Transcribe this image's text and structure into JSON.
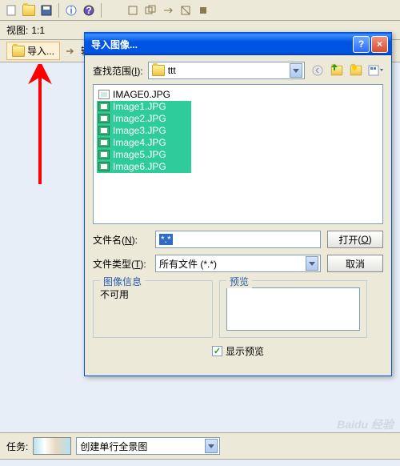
{
  "toolbar": {
    "view_label": "视图:",
    "view_value": "1:1",
    "import_label": "导入...",
    "input_label": "输"
  },
  "dialog": {
    "title": "导入图像...",
    "lookin_label": "查找范围",
    "lookin_hotkey": "I",
    "folder_name": "ttt",
    "files": [
      {
        "name": "IMAGE0.JPG",
        "selected": false
      },
      {
        "name": "Image1.JPG",
        "selected": true
      },
      {
        "name": "Image2.JPG",
        "selected": true
      },
      {
        "name": "Image3.JPG",
        "selected": true
      },
      {
        "name": "Image4.JPG",
        "selected": true
      },
      {
        "name": "Image5.JPG",
        "selected": true
      },
      {
        "name": "Image6.JPG",
        "selected": true
      }
    ],
    "filename_label": "文件名",
    "filename_hotkey": "N",
    "filename_value": "*.*",
    "filetype_label": "文件类型",
    "filetype_hotkey": "T",
    "filetype_value": "所有文件 (*.*)",
    "open_label": "打开",
    "open_hotkey": "O",
    "cancel_label": "取消",
    "imageinfo_legend": "图像信息",
    "imageinfo_text": "不可用",
    "preview_legend": "预览",
    "show_preview_label": "显示预览"
  },
  "taskbar": {
    "label": "任务:",
    "value": "创建单行全景图"
  },
  "watermark": "Baidu 经验"
}
